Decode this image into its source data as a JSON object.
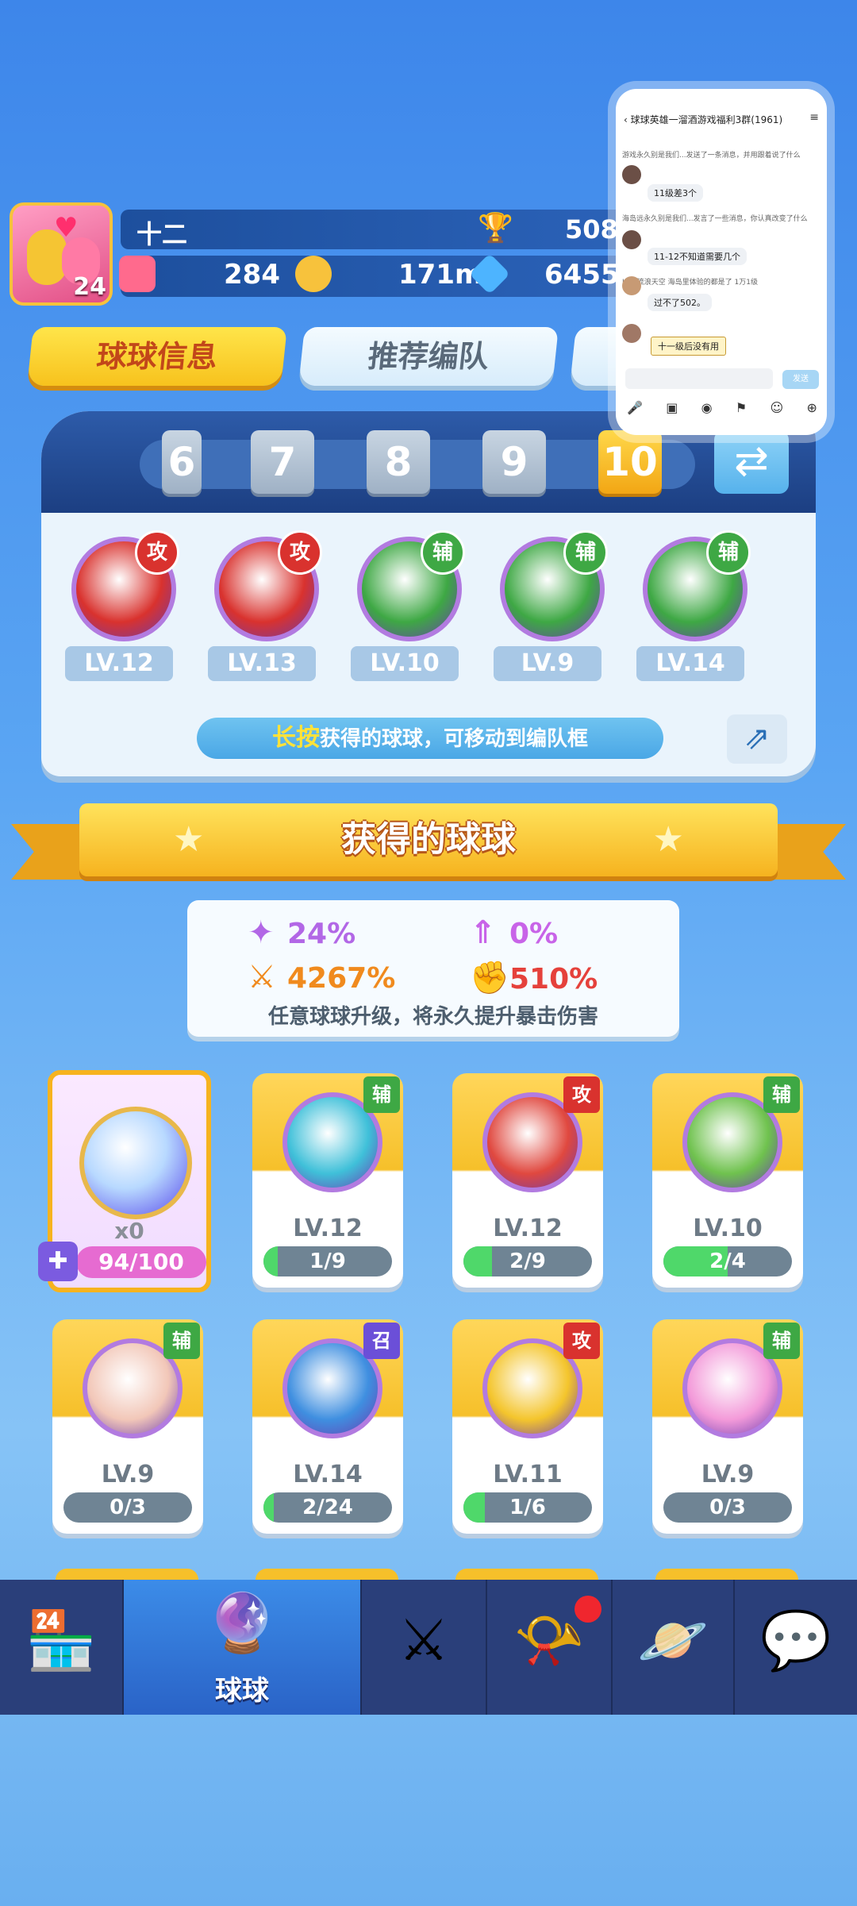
{
  "header": {
    "player_name": "十二",
    "player_level": "24",
    "trophy_score": "508",
    "resources": {
      "tickets": "284",
      "coins": "171m",
      "gems": "6455"
    }
  },
  "tabs": [
    {
      "label": "球球信息"
    },
    {
      "label": "推荐编队"
    }
  ],
  "chat": {
    "title": "球球英雄一溜酒游戏福利3群(1961)",
    "messages": [
      {
        "meta": "游戏永久别是我们...发送了一条消息，并用跟着说了什么",
        "text": "11级差3个"
      },
      {
        "meta": "海岛远永久别是我们...发言了一些消息，你认真改变了什么",
        "text": "11-12不知道需要几个"
      },
      {
        "meta": "LV3 流浪天空 海岛里体验的都是了 1万1级",
        "text": "过不了502。"
      }
    ],
    "tip": "十一级后没有用",
    "send_label": "发送"
  },
  "team": {
    "slots": [
      "6",
      "7",
      "8",
      "9",
      "10"
    ],
    "selected": "10",
    "balls": [
      {
        "type": "攻",
        "level": "LV.12",
        "color": "#d9322e"
      },
      {
        "type": "攻",
        "level": "LV.13",
        "color": "#d9322e"
      },
      {
        "type": "辅",
        "level": "LV.10",
        "color": "#3ea844"
      },
      {
        "type": "辅",
        "level": "LV.9",
        "color": "#3ea844"
      },
      {
        "type": "辅",
        "level": "LV.14",
        "color": "#3ea844"
      }
    ],
    "hint_highlight": "长按",
    "hint_text": "获得的球球，可移动到编队框"
  },
  "section_title": "获得的球球",
  "stats": {
    "s1": "24%",
    "s2": "0%",
    "s3": "4267%",
    "s4": "510%",
    "note": "任意球球升级，将永久提升暴击伤害"
  },
  "special_card": {
    "count": "x0",
    "progress": "94/100",
    "progress_fraction": 0.94
  },
  "owned": [
    {
      "type": "辅",
      "level": "LV.12",
      "progress": "1/9",
      "fraction": 0.111,
      "badge": "#3ea844",
      "orb": "#3fc0d9"
    },
    {
      "type": "攻",
      "level": "LV.12",
      "progress": "2/9",
      "fraction": 0.222,
      "badge": "#d9322e",
      "orb": "#e0483f"
    },
    {
      "type": "辅",
      "level": "LV.10",
      "progress": "2/4",
      "fraction": 0.5,
      "badge": "#3ea844",
      "orb": "#6fc24e"
    },
    {
      "type": "辅",
      "level": "LV.9",
      "progress": "0/3",
      "fraction": 0,
      "badge": "#3ea844",
      "orb": "#f2c7b8"
    },
    {
      "type": "召",
      "level": "LV.14",
      "progress": "2/24",
      "fraction": 0.083,
      "badge": "#6b4fd8",
      "orb": "#3f8fe0"
    },
    {
      "type": "攻",
      "level": "LV.11",
      "progress": "1/6",
      "fraction": 0.167,
      "badge": "#d9322e",
      "orb": "#f4c52c"
    },
    {
      "type": "辅",
      "level": "LV.9",
      "progress": "0/3",
      "fraction": 0,
      "badge": "#3ea844",
      "orb": "#f39ad9"
    }
  ],
  "nav": {
    "active_label": "球球"
  }
}
